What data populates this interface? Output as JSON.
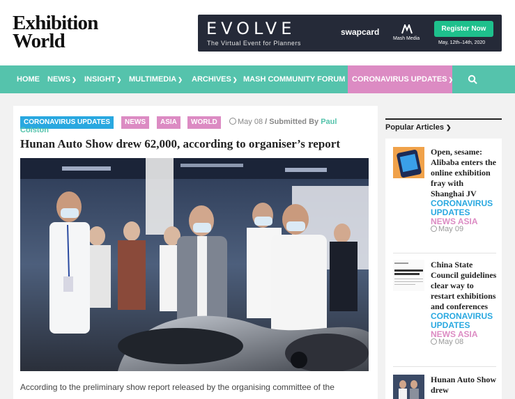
{
  "brand": {
    "logo_line1": "Exhibition",
    "logo_line2": "World"
  },
  "ad": {
    "headline": "EVOLVE",
    "tagline": "The Virtual Event for Planners",
    "partner1": "swapcard",
    "partner2": "Mash Media",
    "cta": "Register Now",
    "dates": "May, 12th–14th, 2020",
    "bg_color": "#252a38",
    "cta_color": "#1ec08c"
  },
  "nav": {
    "items": [
      {
        "label": "HOME",
        "has_menu": false
      },
      {
        "label": "NEWS",
        "has_menu": true
      },
      {
        "label": "INSIGHT",
        "has_menu": true
      },
      {
        "label": "MULTIMEDIA",
        "has_menu": true
      },
      {
        "label": "ARCHIVES",
        "has_menu": true
      },
      {
        "label": "MASH COMMUNITY FORUM",
        "has_menu": false
      },
      {
        "label": "CORONAVIRUS UPDATES",
        "has_menu": true
      }
    ],
    "search_icon": "search-icon",
    "bg_color": "#55c3ac",
    "highlight_color": "#dc8bc3"
  },
  "article": {
    "tags": [
      "CORONAVIRUS UPDATES",
      "NEWS",
      "ASIA",
      "WORLD"
    ],
    "date": "May 08",
    "submitted_by": "/ Submitted By",
    "author_first": "Paul",
    "author_last": "Colston",
    "title": "Hunan Auto Show drew 62,000, according to organiser’s report",
    "para_line1": "According to the preliminary show report released by the organising committee of the"
  },
  "sidebar": {
    "heading": "Popular Articles",
    "items": [
      {
        "title": "Open, sesame: Alibaba enters the online exhibition fray with Shanghai JV",
        "cat_line1": "CORONAVIRUS",
        "cat_line2": "UPDATES",
        "cat2": "NEWS ASIA",
        "date": "May 09"
      },
      {
        "title": "China State Council guidelines clear way to restart exhibitions and conferences",
        "cat_line1": "CORONAVIRUS",
        "cat_line2": "UPDATES",
        "cat2": "NEWS ASIA",
        "date": "May 08"
      },
      {
        "title": "Hunan Auto Show drew"
      }
    ]
  }
}
